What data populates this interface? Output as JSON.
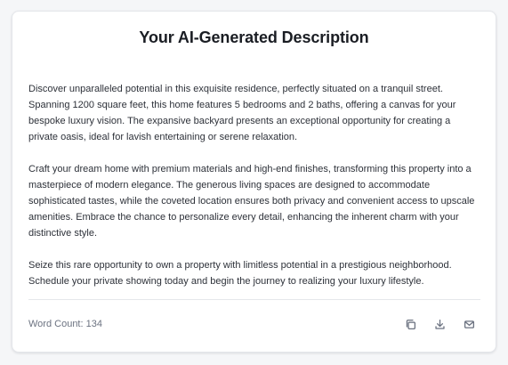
{
  "card": {
    "title": "Your AI-Generated Description",
    "paragraphs": [
      "Discover unparalleled potential in this exquisite residence, perfectly situated on a tranquil street. Spanning 1200 square feet, this home features 5 bedrooms and 2 baths, offering a canvas for your bespoke luxury vision. The expansive backyard presents an exceptional opportunity for creating a private oasis, ideal for lavish entertaining or serene relaxation.",
      "Craft your dream home with premium materials and high-end finishes, transforming this property into a masterpiece of modern elegance. The generous living spaces are designed to accommodate sophisticated tastes, while the coveted location ensures both privacy and convenient access to upscale amenities. Embrace the chance to personalize every detail, enhancing the inherent charm with your distinctive style.",
      "Seize this rare opportunity to own a property with limitless potential in a prestigious neighborhood. Schedule your private showing today and begin the journey to realizing your luxury lifestyle."
    ],
    "word_count": "Word Count: 134"
  },
  "actions": {
    "copy_icon": "copy-icon",
    "download_icon": "download-icon",
    "email_icon": "mail-icon"
  }
}
